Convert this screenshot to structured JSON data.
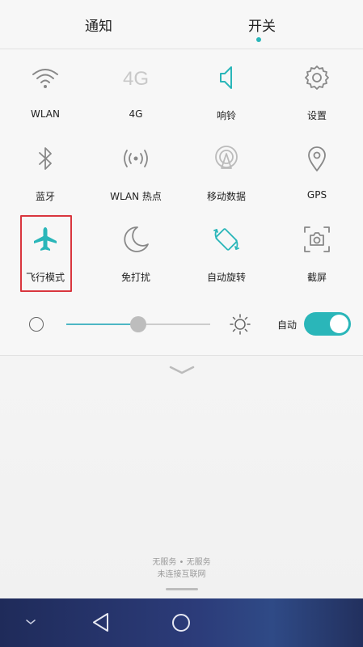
{
  "tabs": {
    "notify": "通知",
    "switch": "开关",
    "active": "switch"
  },
  "tiles": [
    {
      "label": "WLAN",
      "icon": "wifi-icon"
    },
    {
      "label": "4G",
      "icon": "4g-icon",
      "icon_text": "4G"
    },
    {
      "label": "响铃",
      "icon": "speaker-icon"
    },
    {
      "label": "设置",
      "icon": "gear-icon"
    },
    {
      "label": "蓝牙",
      "icon": "bluetooth-icon"
    },
    {
      "label": "WLAN 热点",
      "icon": "hotspot-icon"
    },
    {
      "label": "移动数据",
      "icon": "mobile-data-icon"
    },
    {
      "label": "GPS",
      "icon": "location-pin-icon"
    },
    {
      "label": "飞行模式",
      "icon": "airplane-icon"
    },
    {
      "label": "免打扰",
      "icon": "moon-icon"
    },
    {
      "label": "自动旋转",
      "icon": "rotate-icon"
    },
    {
      "label": "截屏",
      "icon": "screenshot-icon"
    }
  ],
  "brightness": {
    "level": 0.5,
    "auto_label": "自动",
    "auto_enabled": true
  },
  "status": {
    "line1": "无服务 • 无服务",
    "line2": "未连接互联网"
  },
  "colors": {
    "accent": "#2ab6b9",
    "highlight": "#d9363e",
    "icon_gray": "#888888"
  }
}
